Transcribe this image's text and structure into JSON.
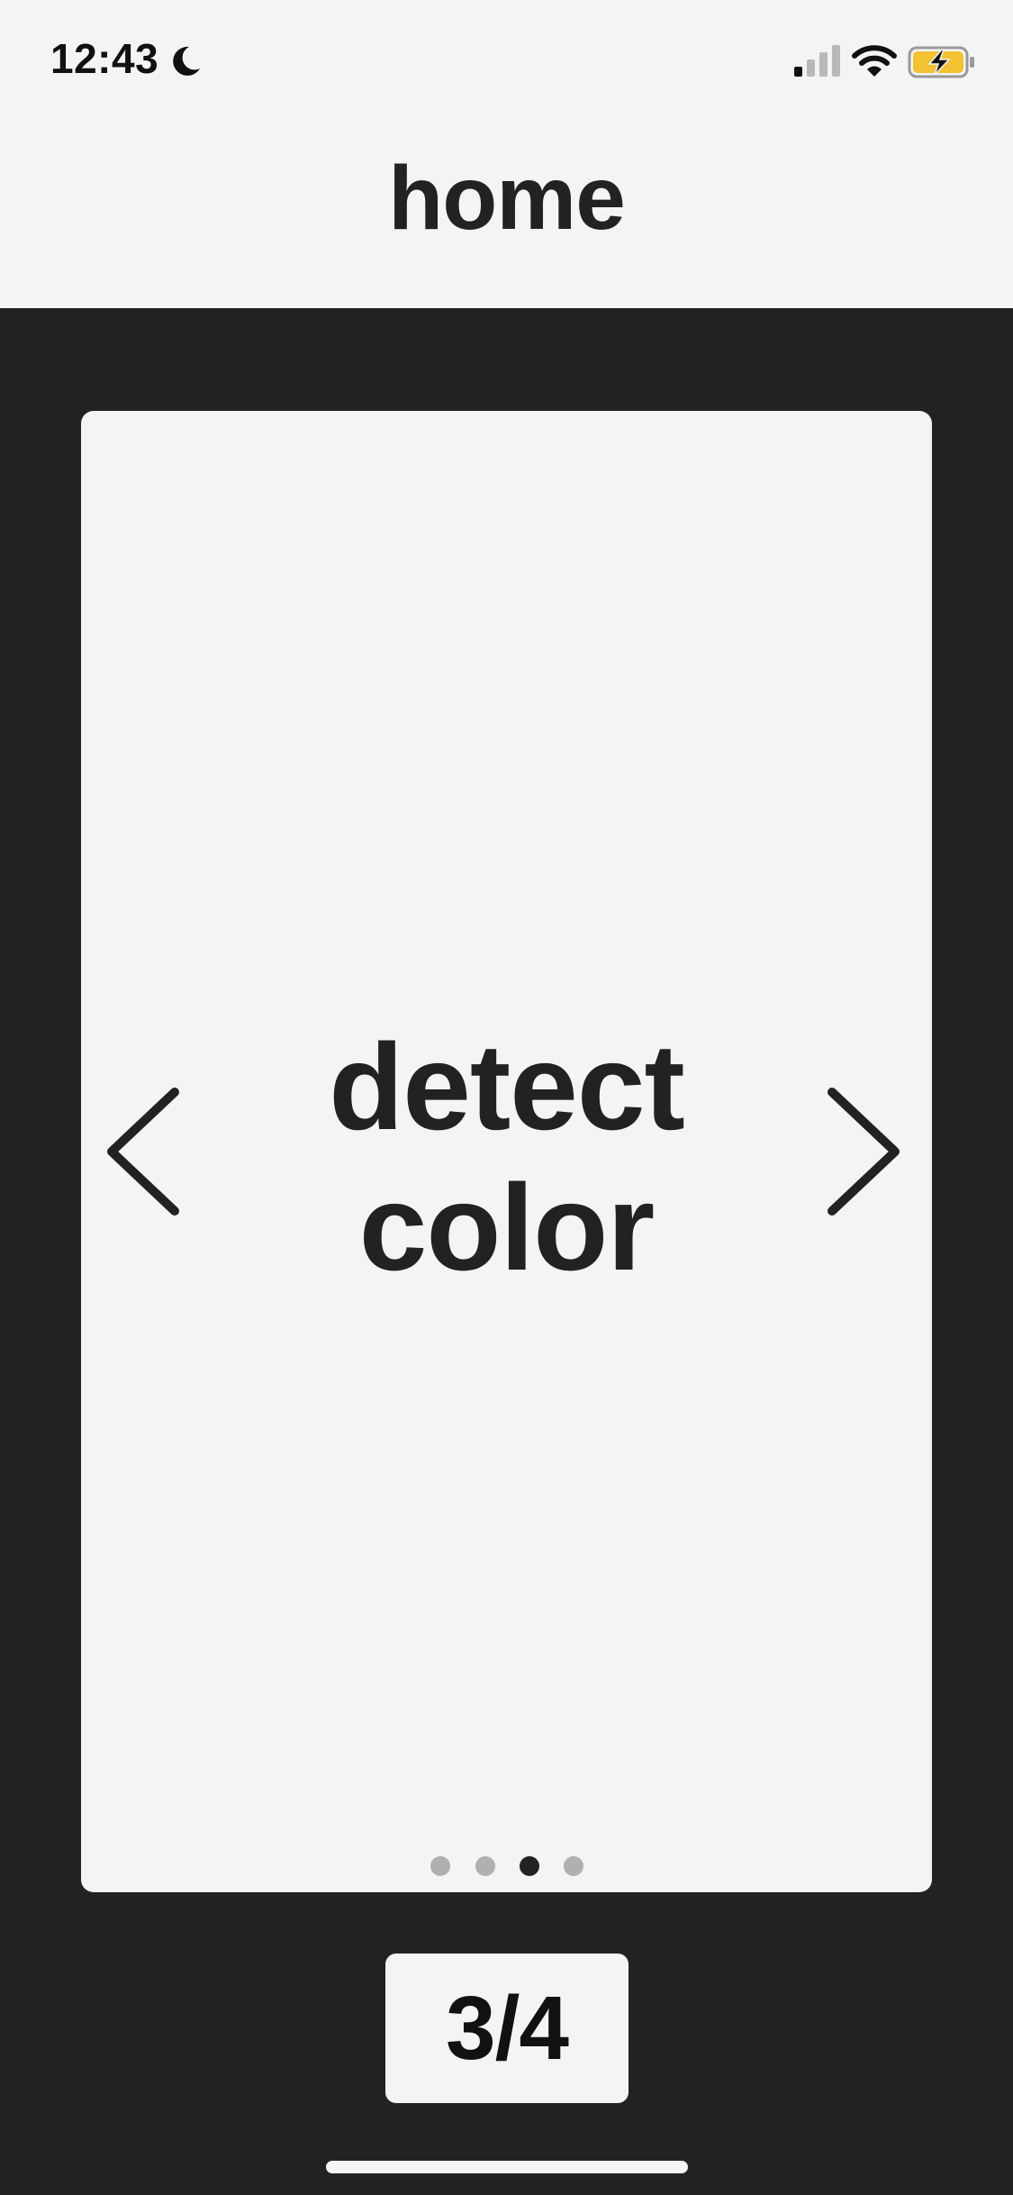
{
  "status_bar": {
    "time": "12:43",
    "icons": [
      "moon-icon",
      "cellular-signal-icon",
      "wifi-icon",
      "battery-charging-icon"
    ],
    "battery_color": "#f2c232"
  },
  "header": {
    "title": "home"
  },
  "carousel": {
    "current_card_label": "detect color",
    "prev_icon": "chevron-left-icon",
    "next_icon": "chevron-right-icon",
    "dot_count": 4,
    "active_index": 3
  },
  "counter": {
    "text": "3/4"
  },
  "colors": {
    "background": "#222222",
    "surface": "#f4f4f4",
    "text": "#222222",
    "inactive_dot": "#b0b0b0"
  }
}
